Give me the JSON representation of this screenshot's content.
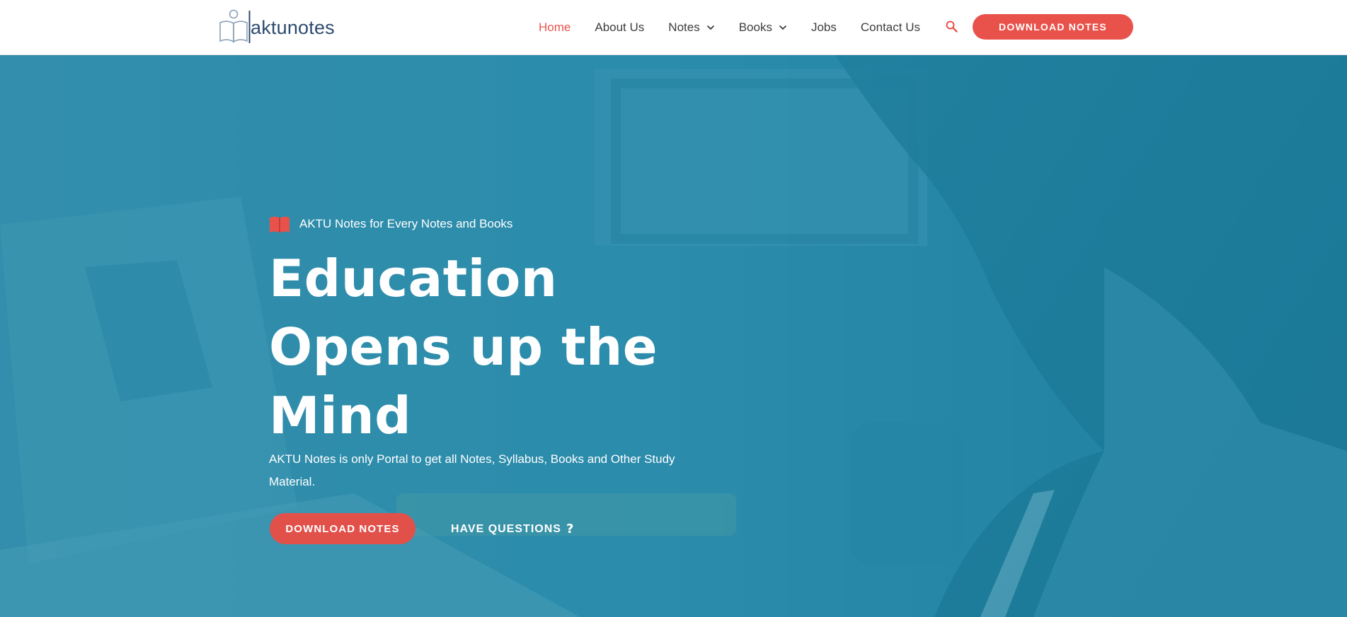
{
  "header": {
    "logo_text": "aktunotes",
    "nav": [
      {
        "label": "Home",
        "active": true
      },
      {
        "label": "About Us"
      },
      {
        "label": "Notes",
        "dropdown": true
      },
      {
        "label": "Books",
        "dropdown": true
      },
      {
        "label": "Jobs"
      },
      {
        "label": "Contact Us"
      }
    ],
    "search_icon": "search-icon",
    "cta_label": "DOWNLOAD NOTES"
  },
  "hero": {
    "tagline_icon": "book-icon",
    "tagline": "AKTU Notes for Every Notes and Books",
    "headline_lines": [
      "Education",
      "Opens up the",
      "Mind"
    ],
    "subtext": "AKTU Notes is only Portal to get all Notes, Syllabus, Books and Other Study Material.",
    "primary_cta": "DOWNLOAD NOTES",
    "secondary_cta": "HAVE QUESTIONS",
    "secondary_icon": "?"
  },
  "colors": {
    "accent": "#e8524b",
    "nav_text": "#3d3d3d",
    "logo_text": "#2d4b6e",
    "hero_overlay": "#1880a0"
  }
}
